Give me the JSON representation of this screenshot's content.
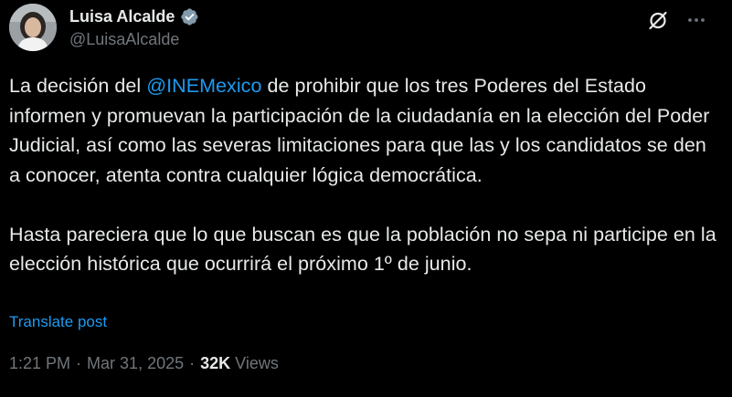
{
  "author": {
    "display_name": "Luisa Alcalde",
    "handle": "@LuisaAlcalde",
    "verified_badge_color": "#829aab"
  },
  "actions": {
    "grok_icon": "grok-slash-circle-icon",
    "more_icon": "more-horizontal-icon"
  },
  "tweet": {
    "paragraph1_prefix": "La decisión del ",
    "mention": "@INEMexico",
    "paragraph1_suffix": " de prohibir que los tres Poderes del Estado informen y promuevan la participación de la ciudadanía en la elección del Poder Judicial, así como las severas limitaciones para que las y los candidatos se den a conocer, atenta contra cualquier lógica democrática.",
    "paragraph2": "Hasta pareciera que lo que buscan es que la población no sepa ni participe en la elección histórica que ocurrirá el próximo 1º de junio."
  },
  "translate_label": "Translate post",
  "meta": {
    "time": "1:21 PM",
    "separator": "·",
    "date": "Mar 31, 2025",
    "views_count": "32K",
    "views_label": "Views"
  },
  "colors": {
    "background": "#000000",
    "text": "#e7e9ea",
    "secondary": "#71767b",
    "link": "#1d9bf0"
  }
}
